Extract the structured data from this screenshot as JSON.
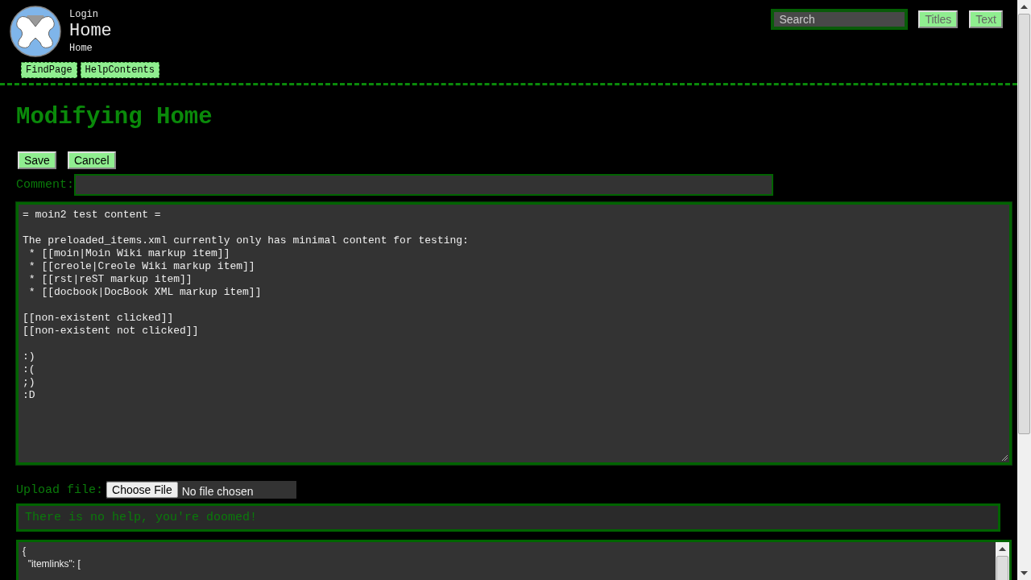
{
  "header": {
    "login": "Login",
    "site_title": "Home",
    "breadcrumb": "Home",
    "nav": [
      "FindPage",
      "HelpContents"
    ]
  },
  "search": {
    "placeholder": "Search",
    "buttons": [
      "Titles",
      "Text"
    ]
  },
  "page_title": "Modifying Home",
  "actions": [
    "Save",
    "Cancel"
  ],
  "comment": {
    "label": "Comment:"
  },
  "editor": {
    "content": "= moin2 test content =\n\nThe preloaded_items.xml currently only has minimal content for testing:\n * [[moin|Moin Wiki markup item]]\n * [[creole|Creole Wiki markup item]]\n * [[rst|reST markup item]]\n * [[docbook|DocBook XML markup item]]\n\n[[non-existent clicked]]\n[[non-existent not clicked]]\n\n:)\n:(\n;)\n:D"
  },
  "upload": {
    "label": "Upload file:",
    "button": "Choose File",
    "status": "No file chosen"
  },
  "help": "There is no help, you're doomed!",
  "metadata": {
    "content": "{\n  \"itemlinks\": ["
  }
}
